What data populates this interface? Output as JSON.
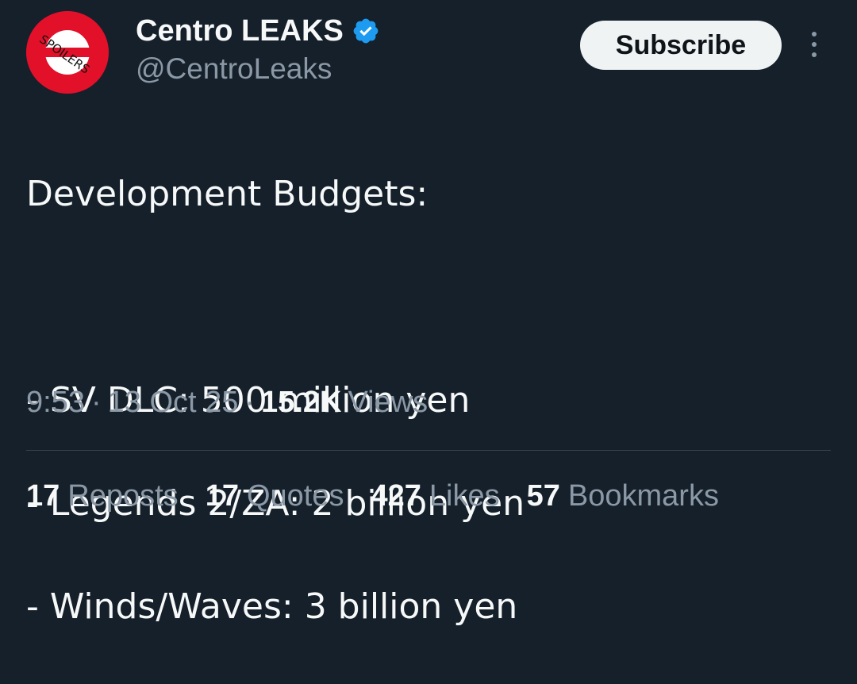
{
  "author": {
    "display_name": "Centro LEAKS",
    "handle": "@CentroLeaks",
    "avatar_text": "SPOILERS",
    "verified_icon": "verified-badge-icon",
    "verified_color": "#1d9bf0",
    "avatar_color": "#e3102a"
  },
  "header": {
    "subscribe_label": "Subscribe",
    "more_icon": "more-vertical-icon"
  },
  "tweet": {
    "lines": [
      "Development Budgets:",
      "",
      "- SV DLC: 500 million yen",
      "- Legends 2/ZA: 2 billion yen",
      "- Winds/Waves: 3 billion yen"
    ]
  },
  "meta": {
    "time": "9:53",
    "date": "13 Oct 25",
    "views_count": "15.2K",
    "views_label": "Views",
    "separator": "·"
  },
  "stats": [
    {
      "count": "17",
      "label": "Reposts"
    },
    {
      "count": "17",
      "label": "Quotes"
    },
    {
      "count": "427",
      "label": "Likes"
    },
    {
      "count": "57",
      "label": "Bookmarks"
    }
  ],
  "colors": {
    "background": "#15202b",
    "text_primary": "#f7f9f9",
    "text_secondary": "#8b98a5",
    "divider": "#38444d"
  }
}
